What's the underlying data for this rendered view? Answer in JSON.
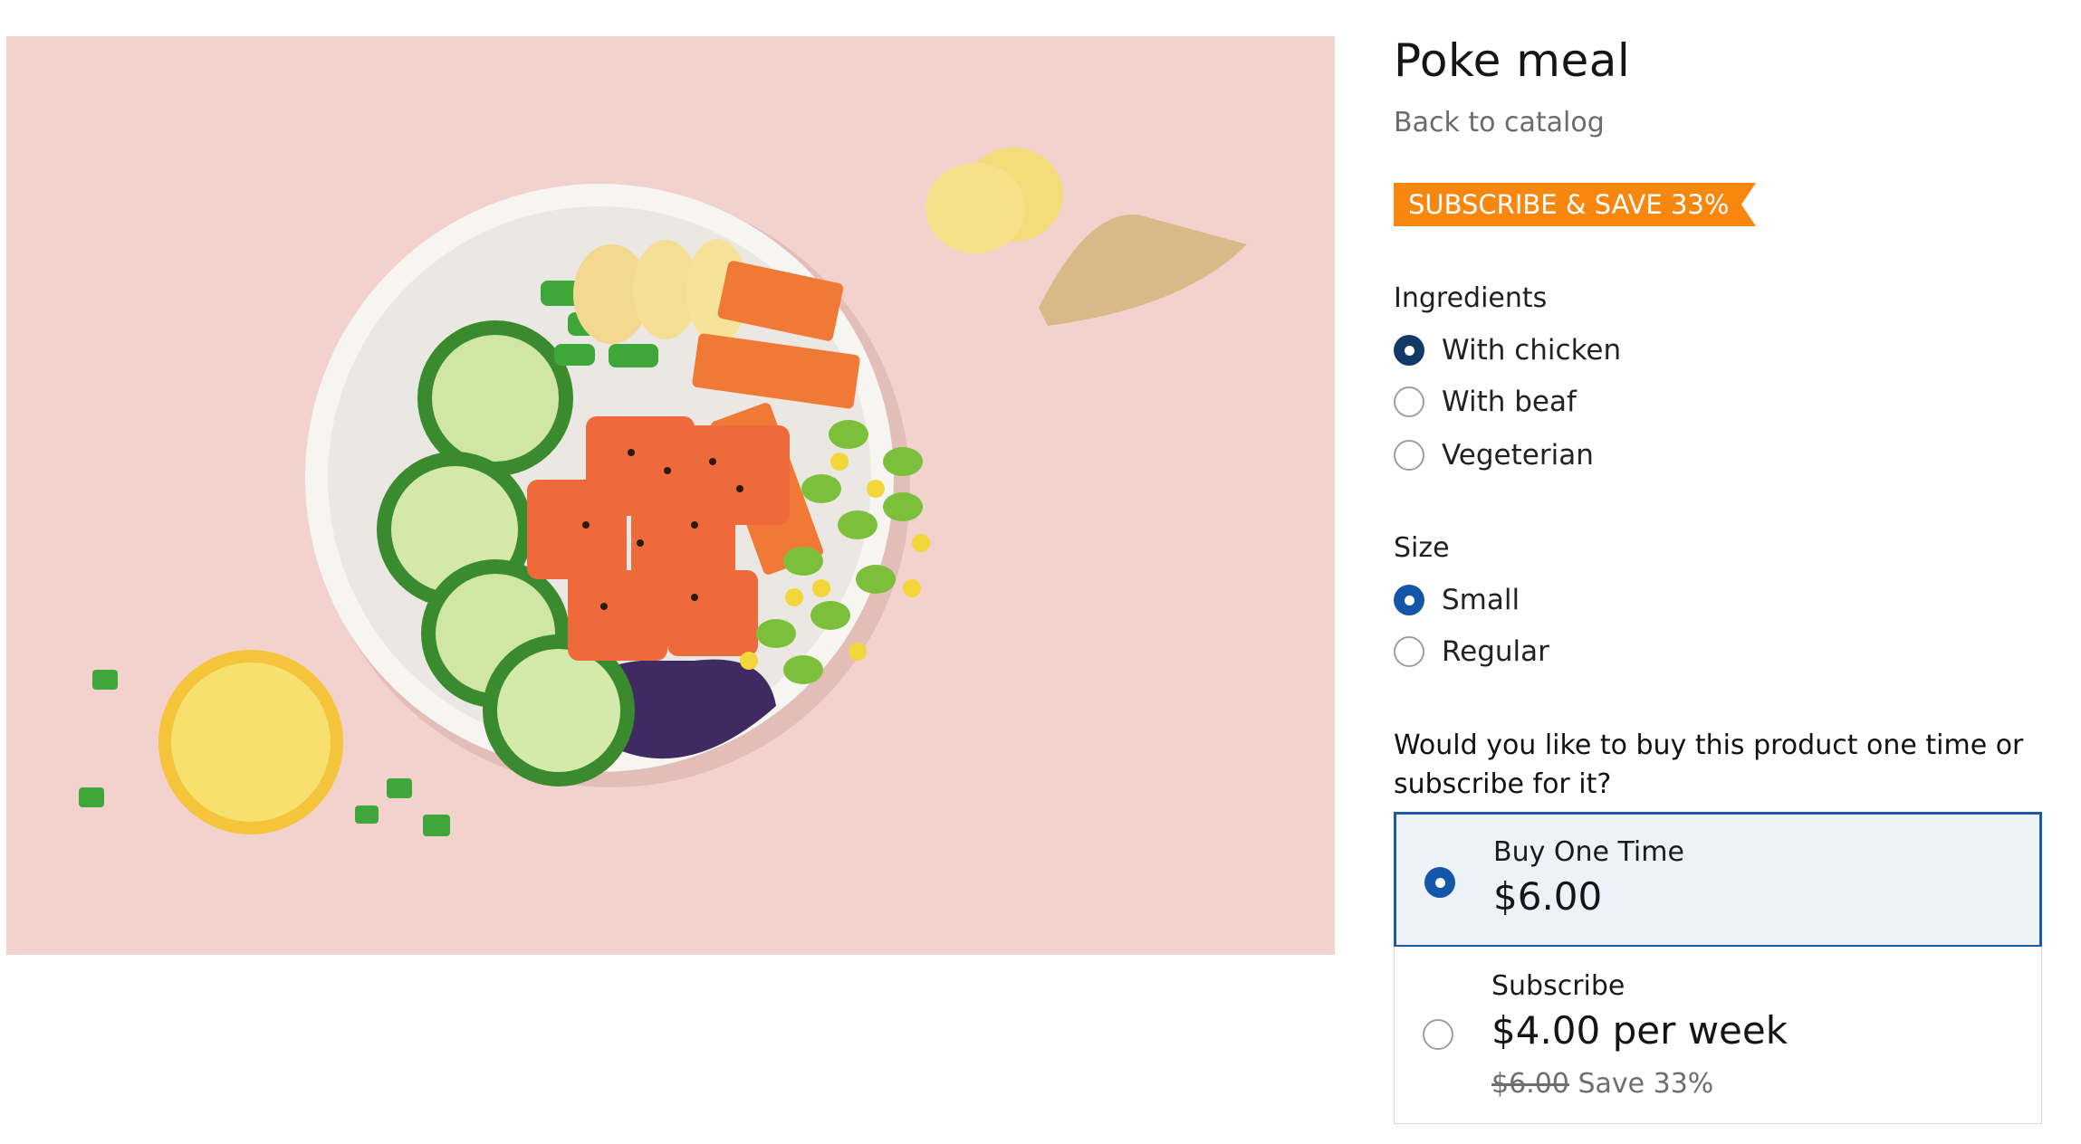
{
  "product": {
    "title": "Poke meal",
    "back_link": "Back to catalog",
    "badge": "SUBSCRIBE & SAVE 33%"
  },
  "ingredients": {
    "label": "Ingredients",
    "options": [
      "With chicken",
      "With beaf",
      "Vegeterian"
    ],
    "selected": "With chicken"
  },
  "size": {
    "label": "Size",
    "options": [
      "Small",
      "Regular"
    ],
    "selected": "Small"
  },
  "purchase": {
    "question": "Would you like to buy this product one time or subscribe for it?",
    "one_time": {
      "name": "Buy One Time",
      "price": "$6.00",
      "selected": true
    },
    "subscribe": {
      "name": "Subscribe",
      "price": "$4.00 per week",
      "old_price": "$6.00",
      "save": "Save 33%",
      "selected": false
    }
  },
  "colors": {
    "badge": "#f7870f",
    "radio_checked": "#1456a8",
    "selected_border": "#1d5aa6",
    "selected_bg": "#edf2f9",
    "photo_bg": "#f3d2cd"
  }
}
